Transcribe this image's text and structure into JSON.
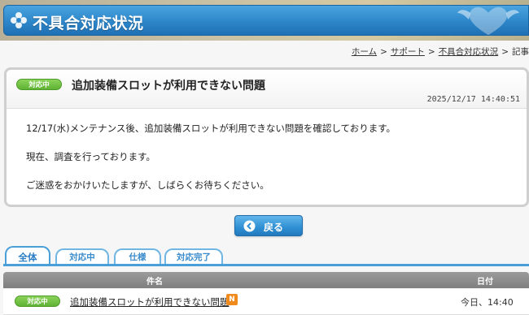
{
  "header": {
    "title": "不具合対応状況",
    "logo_icon": "flower-icon",
    "decoration_icon": "heart-wing-icon"
  },
  "breadcrumb": {
    "items": [
      "ホーム",
      "サポート",
      "不具合対応状況",
      "記事"
    ],
    "separator": ">"
  },
  "article": {
    "status": "対応中",
    "title": "追加装備スロットが利用できない問題",
    "datetime": "2025/12/17 14:40:51",
    "paragraphs": [
      "12/17(水)メンテナンス後、追加装備スロットが利用できない問題を確認しております。",
      "現在、調査を行っております。",
      "ご迷惑をおかけいたしますが、しばらくお待ちください。"
    ]
  },
  "back_button": {
    "label": "戻る",
    "icon": "circle-left-arrow-icon"
  },
  "tabs": [
    {
      "label": "全体",
      "active": true
    },
    {
      "label": "対応中",
      "active": false
    },
    {
      "label": "仕様",
      "active": false
    },
    {
      "label": "対応完了",
      "active": false
    }
  ],
  "table": {
    "headers": {
      "name": "件名",
      "date": "日付"
    },
    "rows": [
      {
        "status": "対応中",
        "title": "追加装備スロットが利用できない問題",
        "badge": "N",
        "date": "今日、14:40"
      }
    ]
  },
  "colors": {
    "header_blue": "#2d86c9",
    "status_green": "#5fb334",
    "tab_blue": "#4a9fd8",
    "table_head_gray": "#8a8a8a",
    "new_badge_orange": "#f08a1c"
  }
}
